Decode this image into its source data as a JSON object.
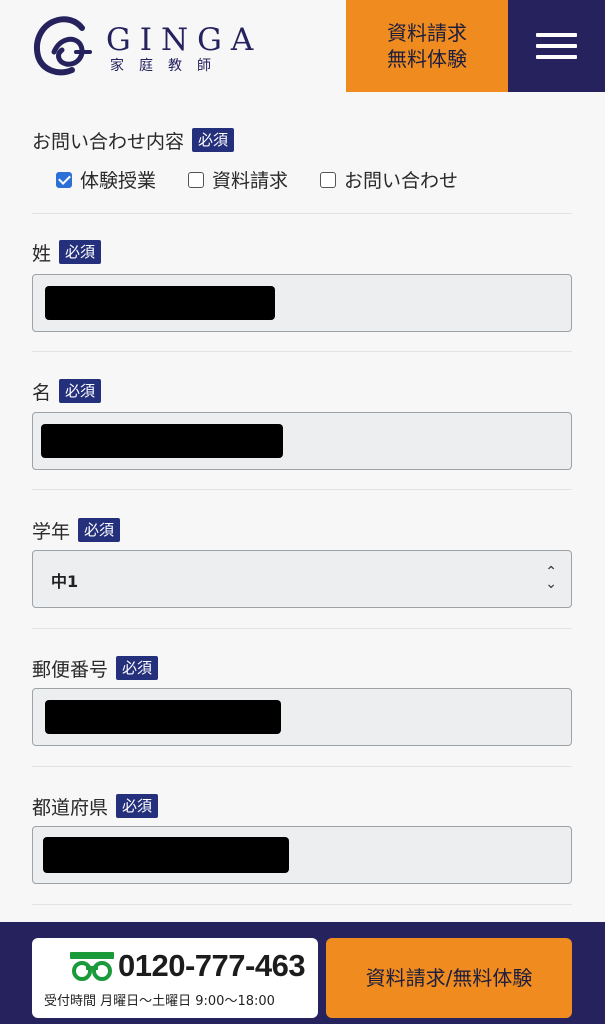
{
  "header": {
    "logo_name": "GINGA",
    "logo_sub": "家庭教師",
    "cta_line1": "資料請求",
    "cta_line2": "無料体験"
  },
  "form": {
    "required_badge": "必須",
    "inquiry": {
      "label": "お問い合わせ内容",
      "options": [
        {
          "label": "体験授業",
          "checked": true
        },
        {
          "label": "資料請求",
          "checked": false
        },
        {
          "label": "お問い合わせ",
          "checked": false
        }
      ]
    },
    "last_name": {
      "label": "姓"
    },
    "first_name": {
      "label": "名"
    },
    "grade": {
      "label": "学年",
      "value": "中1"
    },
    "postal_code": {
      "label": "郵便番号"
    },
    "prefecture": {
      "label": "都道府県"
    }
  },
  "footer": {
    "phone": "0120-777-463",
    "hours": "受付時間 月曜日〜土曜日 9:00〜18:00",
    "cta": "資料請求/無料体験"
  },
  "colors": {
    "navy": "#25225e",
    "orange": "#f08c1f",
    "badge": "#25307c",
    "checkbox": "#2c6fd6",
    "freedial_green": "#1a9a3a"
  }
}
